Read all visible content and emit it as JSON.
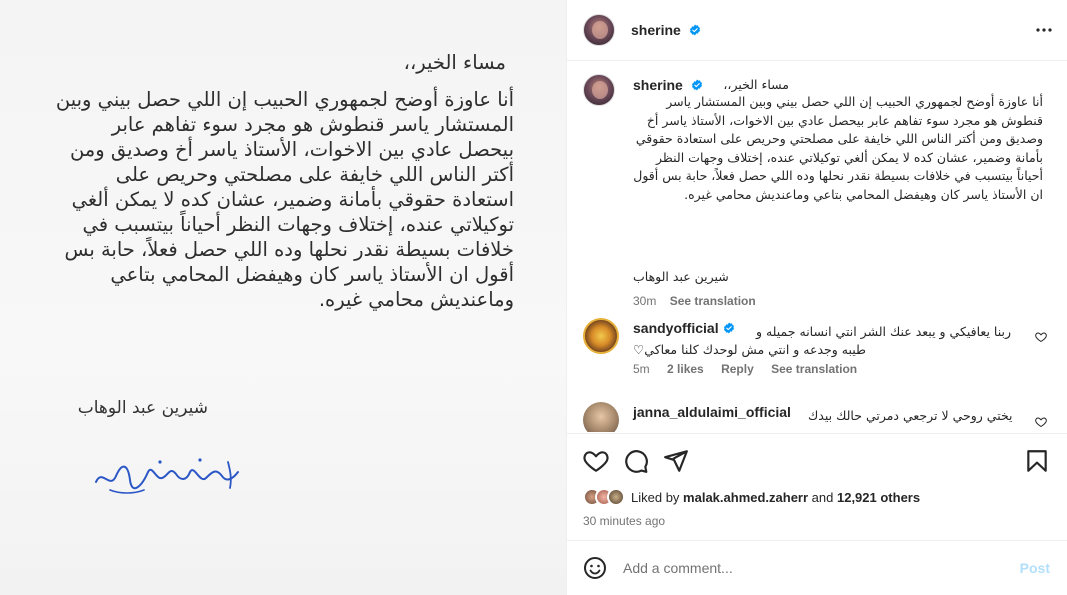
{
  "letter": {
    "greeting": "مساء الخير،،",
    "body": "أنا عاوزة أوضح لجمهوري الحبيب إن اللي حصل بيني وبين المستشار ياسر قنطوش هو مجرد سوء تفاهم عابر بيحصل عادي بين الاخوات، الأستاذ ياسر أخ وصديق ومن أكتر الناس اللي خايفة على مصلحتي وحريص على استعادة حقوقي بأمانة وضمير، عشان كده لا يمكن ألغي توكيلاتي عنده، إختلاف وجهات النظر أحياناً بيتسبب في خلافات بسيطة نقدر نحلها وده اللي حصل فعلاً، حابة بس أقول ان الأستاذ ياسر كان وهيفضل المحامي بتاعي وماعنديش محامي غيره.",
    "name": "شيرين عبد الوهاب",
    "signature": "شيرين عبد الوهاب"
  },
  "header": {
    "username": "sherine"
  },
  "caption": {
    "username": "sherine",
    "first_line": "مساء الخير،،",
    "body": "أنا عاوزة أوضح لجمهوري الحبيب إن اللي حصل بيني وبين المستشار ياسر قنطوش هو مجرد سوء تفاهم عابر بيحصل عادي بين الاخوات، الأستاذ ياسر أخ وصديق ومن أكتر الناس اللي خايفة على مصلحتي وحريص على استعادة حقوقي بأمانة وضمير، عشان كده لا يمكن ألغي توكيلاتي عنده، إختلاف وجهات النظر أحياناً بيتسبب في خلافات بسيطة نقدر نحلها وده اللي حصل فعلاً، حابة بس أقول ان الأستاذ ياسر كان وهيفضل المحامي بتاعي وماعنديش محامي غيره.",
    "signature": "شيرين عبد الوهاب",
    "time": "30m",
    "see_translation": "See translation"
  },
  "comments": [
    {
      "username": "sandyofficial",
      "verified": true,
      "text_line1": "ربنا يعافيكي و يبعد عنك الشر انتي انسانه جميله و",
      "text_line2": "طيبه وجدعه و انتي مش لوحدك كلنا معاكي♡",
      "time": "5m",
      "likes": "2 likes",
      "reply": "Reply",
      "see_translation": "See translation"
    },
    {
      "username": "janna_aldulaimi_official",
      "verified": false,
      "text_line1": "يختي روحي لا ترجعي دمرتي حالك بيدك"
    }
  ],
  "likes": {
    "prefix": "Liked by ",
    "user": "malak.ahmed.zaherr",
    "middle": " and ",
    "others": "12,921 others"
  },
  "timestamp": "30 minutes ago",
  "add_comment": {
    "placeholder": "Add a comment...",
    "post_label": "Post"
  },
  "colors": {
    "verified": "#0095f6",
    "post_button": "#b2dffc",
    "muted": "#737373",
    "text": "#262626"
  },
  "icons": {
    "like": "heart-outline",
    "comment": "speech-bubble",
    "share": "paper-plane",
    "save": "bookmark",
    "more": "three-dots",
    "emoji": "smiley-face"
  }
}
